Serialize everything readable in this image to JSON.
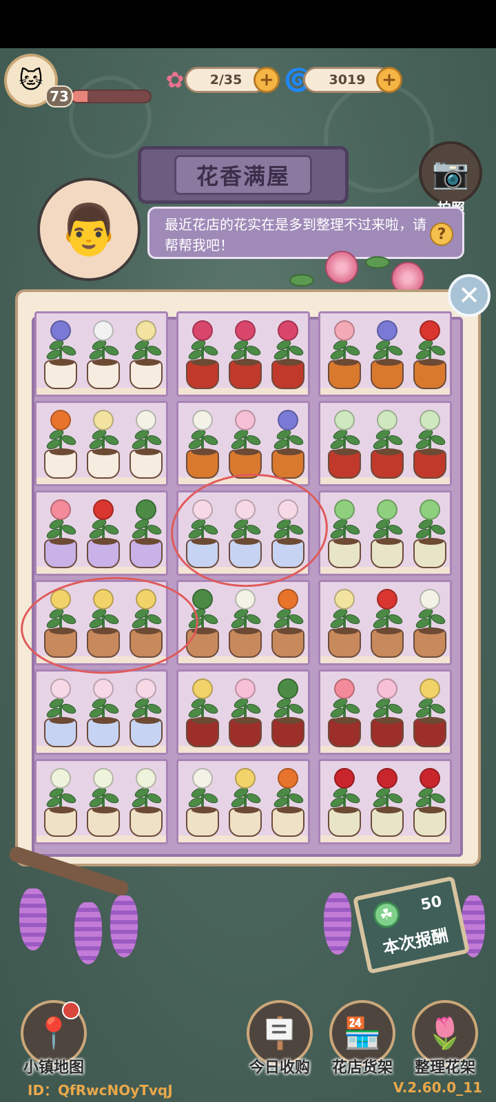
{
  "hud": {
    "level": "73",
    "xp_fraction": 0.2,
    "flowers": "2/35",
    "currency": "3019",
    "plus": "+"
  },
  "title": "花香满屋",
  "camera": {
    "label": "拍照"
  },
  "npc": {
    "dialog": "最近花店的花实在是多到整理不过来啦，请帮帮我吧！",
    "help": "?"
  },
  "close": "✕",
  "shelf": {
    "cells": [
      {
        "pots": [
          "cat",
          "cat",
          "cat"
        ],
        "flowers": [
          "#7a7ad6",
          "#f2f2f2",
          "#f2e3a0"
        ]
      },
      {
        "pots": [
          "redtub",
          "redtub",
          "redtub"
        ],
        "flowers": [
          "#d9466b",
          "#d9466b",
          "#d9466b"
        ]
      },
      {
        "pots": [
          "orange",
          "orange",
          "orange"
        ],
        "flowers": [
          "#f4a9b6",
          "#7a7ad6",
          "#d9362f"
        ]
      },
      {
        "pots": [
          "cat",
          "cat",
          "cat"
        ],
        "flowers": [
          "#e8742c",
          "#f2e3a0",
          "#f2f2e6"
        ]
      },
      {
        "pots": [
          "orange",
          "orange",
          "orange"
        ],
        "flowers": [
          "#f2f2e6",
          "#f7c0d6",
          "#7a7ad6"
        ]
      },
      {
        "pots": [
          "redtub",
          "redtub",
          "redtub"
        ],
        "flowers": [
          "#cfe8c0",
          "#cfe8c0",
          "#cfe8c0"
        ]
      },
      {
        "pots": [
          "lilac",
          "lilac",
          "lilac"
        ],
        "flowers": [
          "#f48b9a",
          "#d9362f",
          "#4c8b46"
        ]
      },
      {
        "pots": [
          "glass",
          "glass",
          "glass"
        ],
        "flowers": [
          "#f7d9e6",
          "#f7d9e6",
          "#f7d9e6"
        ]
      },
      {
        "pots": [
          "cream",
          "cream",
          "cream"
        ],
        "flowers": [
          "#8fd07f",
          "#8fd07f",
          "#8fd07f"
        ]
      },
      {
        "pots": [
          "terra",
          "terra",
          "terra"
        ],
        "flowers": [
          "#f2d36a",
          "#f2d36a",
          "#f2d36a"
        ]
      },
      {
        "pots": [
          "terra",
          "terra",
          "terra"
        ],
        "flowers": [
          "#4c8b46",
          "#f2f2e6",
          "#e8742c"
        ]
      },
      {
        "pots": [
          "terra",
          "terra",
          "terra"
        ],
        "flowers": [
          "#f2e3a0",
          "#d9362f",
          "#f2f2e6"
        ]
      },
      {
        "pots": [
          "glass",
          "glass",
          "glass"
        ],
        "flowers": [
          "#f7d9e6",
          "#f7d9e6",
          "#f7d9e6"
        ]
      },
      {
        "pots": [
          "maroon",
          "maroon",
          "maroon"
        ],
        "flowers": [
          "#f2d36a",
          "#f7c0d6",
          "#4c8b46"
        ]
      },
      {
        "pots": [
          "maroon",
          "maroon",
          "maroon"
        ],
        "flowers": [
          "#f48b9a",
          "#f7c0d6",
          "#f2d36a"
        ]
      },
      {
        "pots": [
          "bow",
          "bow",
          "bow"
        ],
        "flowers": [
          "#eef3dc",
          "#eef3dc",
          "#eef3dc"
        ]
      },
      {
        "pots": [
          "bow",
          "bow",
          "bow"
        ],
        "flowers": [
          "#f2f2e6",
          "#f2d36a",
          "#e8742c"
        ]
      },
      {
        "pots": [
          "cream",
          "cream",
          "cream"
        ],
        "flowers": [
          "#c8262c",
          "#c8262c",
          "#c8262c"
        ]
      }
    ]
  },
  "reward": {
    "value": "50",
    "label": "本次报酬"
  },
  "nav": {
    "map": "小镇地图",
    "today": "今日收购",
    "shop": "花店货架",
    "organize": "整理花架"
  },
  "footer": {
    "uid": "ID：QfRwcNOyTvqJ",
    "version": "V.2.60.0_11"
  },
  "colors": {
    "pots": {
      "cat": "#f6ecdf",
      "redtub": "#c0392b",
      "orange": "#d9792e",
      "lilac": "#c8b2e8",
      "glass": "#c7d3f2",
      "cream": "#e8e4c8",
      "terra": "#c88a5c",
      "maroon": "#9c2f2a",
      "bow": "#efe1c6"
    }
  }
}
